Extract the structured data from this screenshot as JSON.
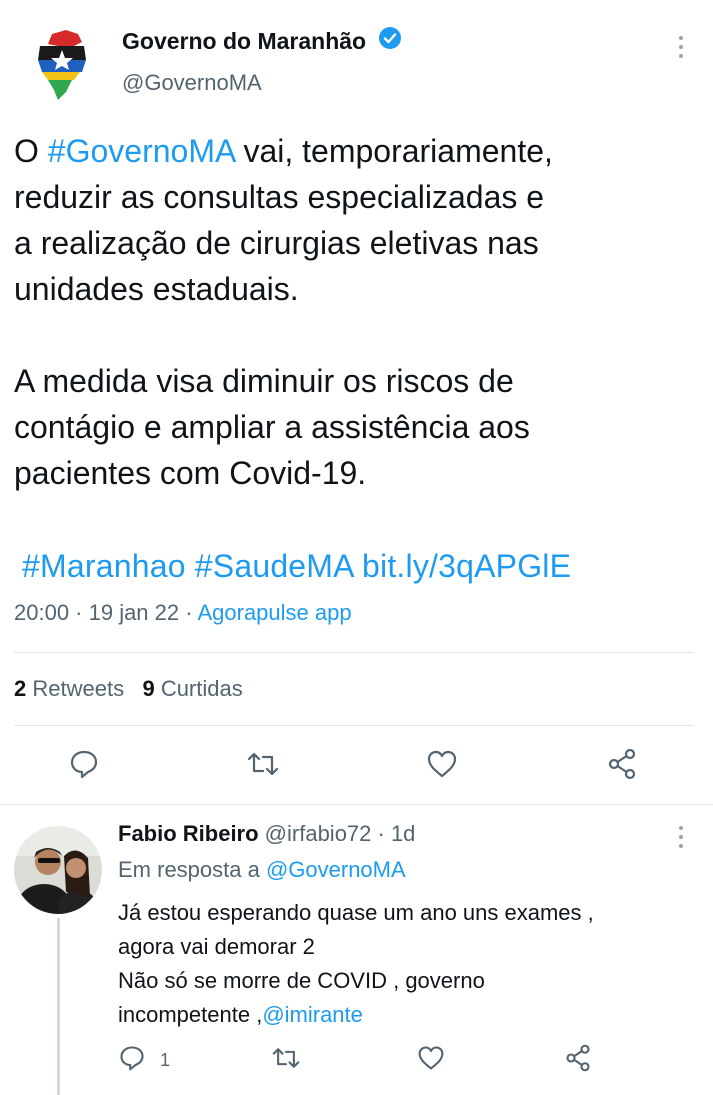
{
  "tweet": {
    "author_name": "Governo do Maranhão",
    "author_handle": "@GovernoMA",
    "text_prefix": "O ",
    "text_hashtag": "#GovernoMA",
    "text_rest": " vai, temporariamente,\nreduzir as consultas especializadas e\na realização de cirurgias eletivas nas\nunidades estaduais.\n\nA medida visa diminuir os riscos de\ncontágio e ampliar a assistência aos\npacientes com Covid-19.",
    "hashtags_links": "#Maranhao #SaudeMA bit.ly/3qAPGlE",
    "time": "20:00 · 19 jan 22 · ",
    "source": "Agorapulse app",
    "retweets_count": "2",
    "retweets_label": "Retweets",
    "likes_count": "9",
    "likes_label": "Curtidas"
  },
  "reply": {
    "author_name": "Fabio Ribeiro",
    "author_handle_time": " @irfabio72 · 1d",
    "replying_to_prefix": "Em resposta a ",
    "replying_to_handle": "@GovernoMA",
    "text": "Já estou esperando quase um ano uns exames ,\nagora vai demorar 2\nNão só se morre de COVID , governo\nincompetente ,",
    "mention": "@imirante",
    "reply_count": "1"
  },
  "colors": {
    "accent": "#1d9bf0",
    "secondary_text": "#536471",
    "primary_text": "#0f1419"
  },
  "icons": {
    "verified": "verified-badge-icon",
    "more": "more-vertical-icon",
    "reply": "reply-icon",
    "retweet": "retweet-icon",
    "like": "heart-icon",
    "share": "share-icon"
  }
}
